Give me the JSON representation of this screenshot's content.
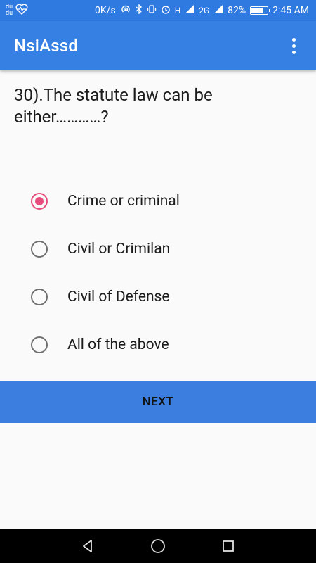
{
  "status_bar": {
    "left_top": "du",
    "left_bottom": "du",
    "speed": "0K/s",
    "network_h": "H",
    "network_2g": "2G",
    "battery_percent": "82%",
    "battery_level": 0.82,
    "time": "2:45 AM"
  },
  "app_bar": {
    "title": "NsiAssd"
  },
  "question": {
    "text": "30).The statute law can be either…………?"
  },
  "options": [
    {
      "label": "Crime or criminal",
      "checked": true
    },
    {
      "label": "Civil or Crimilan",
      "checked": false
    },
    {
      "label": "Civil of Defense",
      "checked": false
    },
    {
      "label": "All of the above",
      "checked": false
    }
  ],
  "actions": {
    "next_label": "NEXT"
  },
  "colors": {
    "status_bar": "#2f7ae0",
    "app_bar": "#3580e2",
    "accent": "#e64d7c",
    "button": "#3b7ee0"
  }
}
